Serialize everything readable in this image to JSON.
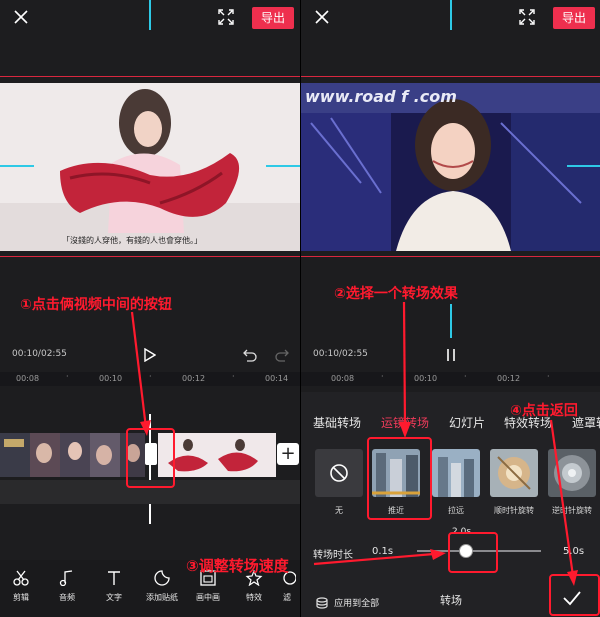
{
  "left": {
    "export_label": "导出",
    "subtitle": "「沒錢的人穿他，有錢的人也會穿他。」",
    "time": "00:10/02:55",
    "ruler": [
      "00:08",
      "00:10",
      "00:12",
      "00:14"
    ],
    "annotation": "①点击俩视频中间的按钮",
    "add_label": "+",
    "tools": [
      {
        "icon": "scissors-icon",
        "label": "剪辑"
      },
      {
        "icon": "music-note-icon",
        "label": "音频"
      },
      {
        "icon": "text-icon",
        "label": "文字"
      },
      {
        "icon": "sticker-icon",
        "label": "添加贴纸"
      },
      {
        "icon": "picture-in-picture-icon",
        "label": "画中画"
      },
      {
        "icon": "effects-icon",
        "label": "特效"
      },
      {
        "icon": "more-icon",
        "label": "滤"
      }
    ]
  },
  "right": {
    "export_label": "导出",
    "watermark": "www.road f .com",
    "time": "00:10/02:55",
    "ruler": [
      "00:08",
      "00:10",
      "00:12"
    ],
    "annotation2": "②选择一个转场效果",
    "annotation3": "③调整转场速度",
    "annotation4": "④点击返回",
    "tabs": [
      "基础转场",
      "运镜转场",
      "幻灯片",
      "特效转场",
      "遮罩转"
    ],
    "active_tab": "运镜转场",
    "transitions": [
      {
        "label": "无"
      },
      {
        "label": "推近"
      },
      {
        "label": "拉远"
      },
      {
        "label": "顺时针旋转"
      },
      {
        "label": "逆时针旋转"
      }
    ],
    "duration_label": "转场时长",
    "duration_min": "0.1s",
    "duration_value": "2.0s",
    "duration_max": "5.0s",
    "duration_fraction": 0.39,
    "apply_all": "应用到全部",
    "bottom_title": "转场"
  },
  "colors": {
    "accent": "#ee2f4e",
    "annotation": "#ff1a2e",
    "guide": "#2ec9e6"
  }
}
